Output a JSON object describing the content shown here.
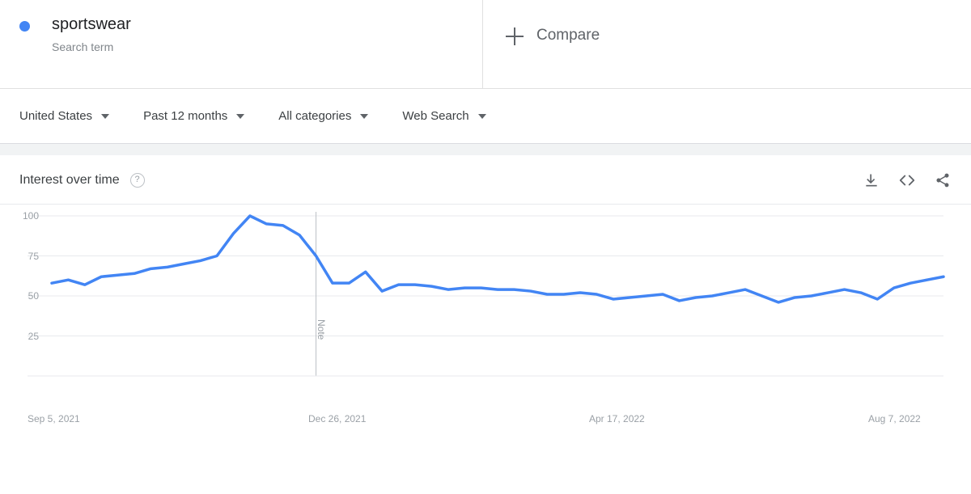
{
  "search_term": {
    "name": "sportswear",
    "type_label": "Search term",
    "dot_color": "#4285F4"
  },
  "compare": {
    "label": "Compare",
    "icon": "plus-icon"
  },
  "filters": [
    {
      "label": "United States",
      "name": "region-filter"
    },
    {
      "label": "Past 12 months",
      "name": "time-range-filter"
    },
    {
      "label": "All categories",
      "name": "category-filter"
    },
    {
      "label": "Web Search",
      "name": "search-type-filter"
    }
  ],
  "card": {
    "title": "Interest over time",
    "help_icon": "question-mark-icon",
    "help_glyph": "?",
    "actions": [
      {
        "name": "download-csv-icon",
        "label": "download-icon"
      },
      {
        "name": "embed-code-icon",
        "label": "embed-icon"
      },
      {
        "name": "share-icon",
        "label": "share-icon"
      }
    ]
  },
  "chart_data": {
    "type": "line",
    "title": "Interest over time",
    "xlabel": "",
    "ylabel": "",
    "line_color": "#4285F4",
    "line_width": 3.5,
    "grid": true,
    "grid_color": "#e8eaed",
    "legend": "sportswear",
    "legend_position": "top",
    "ylim": [
      0,
      100
    ],
    "yticks": [
      100,
      75,
      50,
      25
    ],
    "ytick_labels": [
      "100",
      "75",
      "50",
      "25"
    ],
    "xtick_labels": [
      "Sep 5, 2021",
      "Dec 26, 2021",
      "Apr 17, 2022",
      "Aug 7, 2022"
    ],
    "xtick_positions": [
      0,
      16,
      32,
      48
    ],
    "annotations": [
      {
        "type": "vertical-line",
        "label": "Note",
        "x_index": 16
      }
    ],
    "x": [
      "Sep 5, 2021",
      "Sep 12, 2021",
      "Sep 19, 2021",
      "Sep 26, 2021",
      "Oct 3, 2021",
      "Oct 10, 2021",
      "Oct 17, 2021",
      "Oct 24, 2021",
      "Oct 31, 2021",
      "Nov 7, 2021",
      "Nov 14, 2021",
      "Nov 21, 2021",
      "Nov 28, 2021",
      "Dec 5, 2021",
      "Dec 12, 2021",
      "Dec 19, 2021",
      "Dec 26, 2021",
      "Jan 2, 2022",
      "Jan 9, 2022",
      "Jan 16, 2022",
      "Jan 23, 2022",
      "Jan 30, 2022",
      "Feb 6, 2022",
      "Feb 13, 2022",
      "Feb 20, 2022",
      "Feb 27, 2022",
      "Mar 6, 2022",
      "Mar 13, 2022",
      "Mar 20, 2022",
      "Mar 27, 2022",
      "Apr 3, 2022",
      "Apr 10, 2022",
      "Apr 17, 2022",
      "Apr 24, 2022",
      "May 1, 2022",
      "May 8, 2022",
      "May 15, 2022",
      "May 22, 2022",
      "May 29, 2022",
      "Jun 5, 2022",
      "Jun 12, 2022",
      "Jun 19, 2022",
      "Jun 26, 2022",
      "Jul 3, 2022",
      "Jul 10, 2022",
      "Jul 17, 2022",
      "Jul 24, 2022",
      "Jul 31, 2022",
      "Aug 7, 2022"
    ],
    "values": [
      58,
      60,
      57,
      62,
      63,
      64,
      67,
      68,
      70,
      72,
      75,
      89,
      100,
      95,
      94,
      88,
      75,
      58,
      58,
      65,
      53,
      57,
      57,
      56,
      54,
      55,
      55,
      54,
      54,
      53,
      51,
      51,
      52,
      51,
      48,
      49,
      50,
      51,
      47,
      49,
      50,
      52,
      54,
      50,
      46,
      49,
      50,
      52,
      54,
      52,
      48,
      55,
      58,
      60,
      62
    ],
    "peak": {
      "value": 100,
      "x": "Nov 28, 2021"
    },
    "min": {
      "value": 46,
      "x": "Jun 26, 2022"
    }
  }
}
